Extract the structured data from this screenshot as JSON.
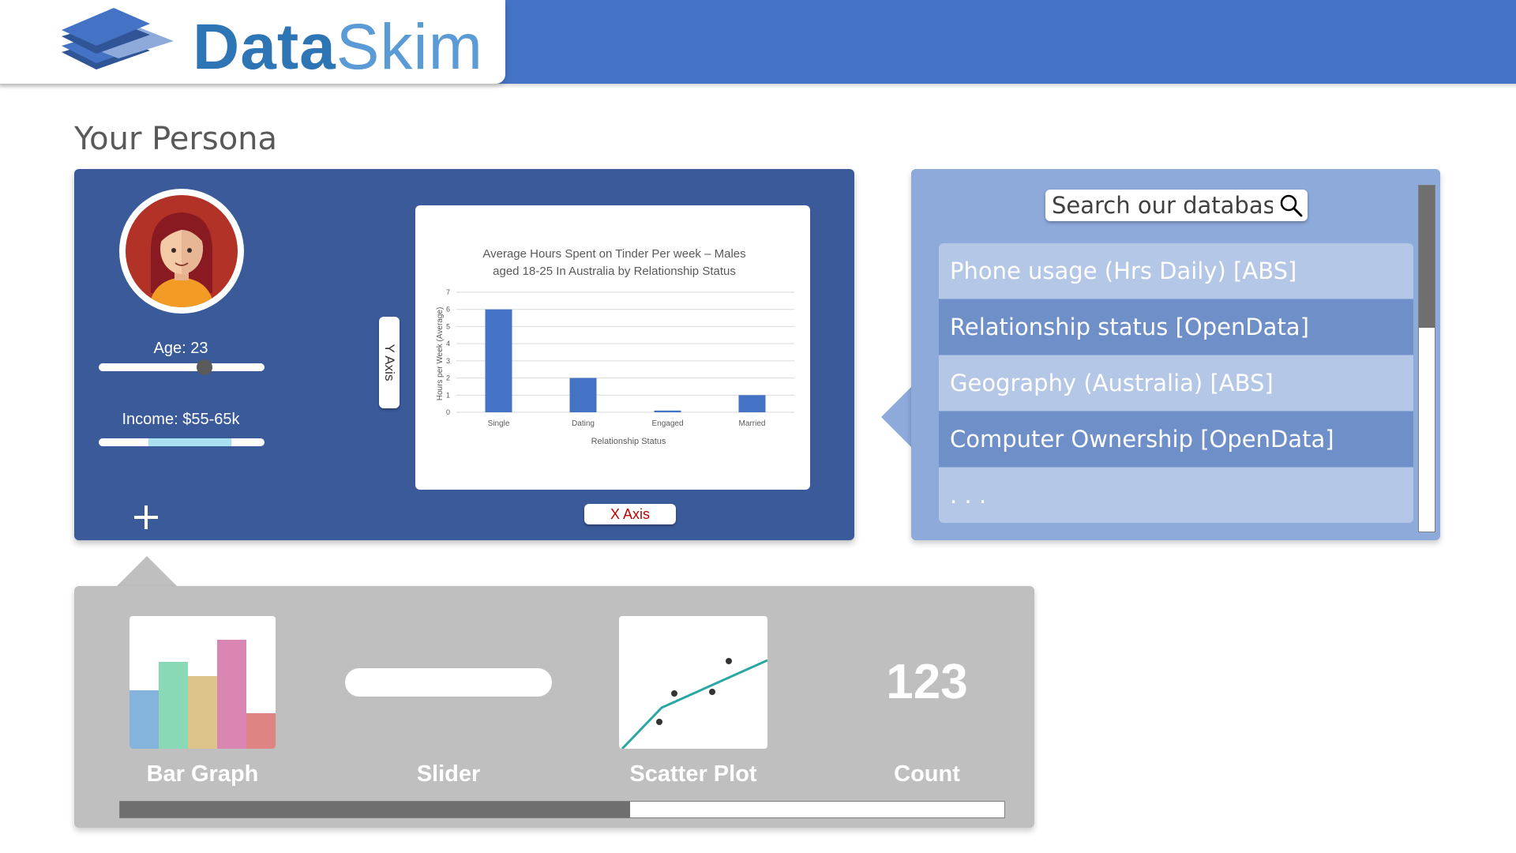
{
  "app": {
    "logo_text_bold": "Data",
    "logo_text_light": "Skim",
    "logo_icon": "stacked-layers-icon"
  },
  "page_title": "Your Persona",
  "persona": {
    "avatar_icon": "female-avatar-icon",
    "age_label": "Age: 23",
    "age_slider_level": 0.64,
    "income_label": "Income: $55-65k",
    "income_range_level": [
      0.3,
      0.8
    ],
    "add_icon": "plus-icon"
  },
  "axis_buttons": {
    "y_label": "Y Axis",
    "x_label": "X Axis"
  },
  "chart_data": {
    "type": "bar",
    "title_line1": "Average Hours Spent on Tinder Per week – Males",
    "title_line2": "aged 18-25 In Australia by Relationship Status",
    "xlabel": "Relationship Status",
    "ylabel": "Hours per Week (Average)",
    "categories": [
      "Single",
      "Dating",
      "Engaged",
      "Married"
    ],
    "values": [
      6,
      2,
      0.1,
      1
    ],
    "yticks": [
      "0",
      "1",
      "2",
      "3",
      "4",
      "5",
      "6",
      "7"
    ],
    "ylim": [
      0,
      7
    ],
    "grid": true,
    "bar_color": "#4472c4"
  },
  "search": {
    "placeholder": "Search our database",
    "icon": "magnifier-icon",
    "items": [
      "Phone usage (Hrs Daily) [ABS]",
      "Relationship status [OpenData]",
      "Geography (Australia) [ABS]",
      "Computer Ownership [OpenData]",
      ". . ."
    ]
  },
  "widgets": {
    "bar_graph_label": "Bar Graph",
    "slider_label": "Slider",
    "scatter_label": "Scatter Plot",
    "count_label": "Count",
    "count_value": "123",
    "bar_colors": [
      "#84b3dc",
      "#89d8b6",
      "#ddc48a",
      "#d986b3",
      "#de8583"
    ]
  },
  "colors": {
    "header": "#4472c4",
    "persona_panel": "#3a5a9a",
    "search_panel": "#8eaadb",
    "palette": "#bfbfbf"
  }
}
